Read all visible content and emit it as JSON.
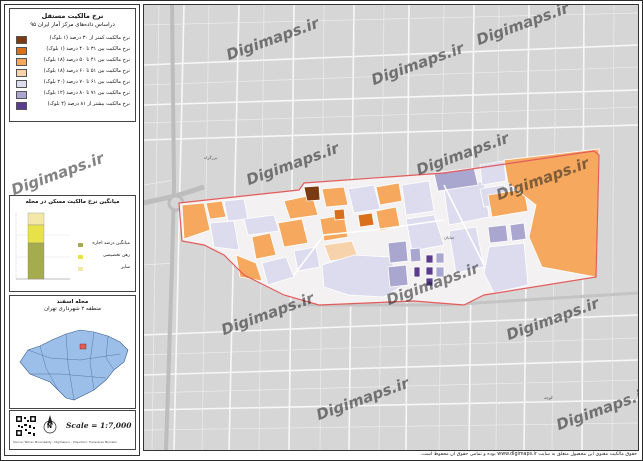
{
  "legend": {
    "title": "نرخ مالکیت مستقل",
    "subtitle": "دراساس داده‌های مرکز آمار ایران ۹۵",
    "items": [
      {
        "label": "نرخ مالکیت کمتر از ۳۰ درصد (۱ بلوک)",
        "color": "#7a3b12"
      },
      {
        "label": "نرخ مالکیت بین ۳۱ تا ۴۰ درصد (۱ بلوک)",
        "color": "#d9701c"
      },
      {
        "label": "نرخ مالکیت بین ۴۱ تا ۵۰ درصد (۱۸ بلوک)",
        "color": "#f5a85e"
      },
      {
        "label": "نرخ مالکیت بین ۵۱ تا ۶۰ درصد (۱۸ بلوک)",
        "color": "#f7d3ab"
      },
      {
        "label": "نرخ مالکیت بین ۶۱ تا ۷۰ درصد (۲۰ بلوک)",
        "color": "#dcdcee"
      },
      {
        "label": "نرخ مالکیت بین ۷۱ تا ۸۰ درصد (۱۲ بلوک)",
        "color": "#a9a6cf"
      },
      {
        "label": "نرخ مالکیت بیشتر از ۸۱ درصد (۴ بلوک)",
        "color": "#5b3d8f"
      }
    ]
  },
  "chart": {
    "title": "میانگین نرخ مالکیت مسکن در محله",
    "items": [
      {
        "label": "میانگین درصد اجاره",
        "color": "#a4ac4e"
      },
      {
        "label": "رهن تخصیصی",
        "color": "#e8e24a"
      },
      {
        "label": "سایر",
        "color": "#f4e8a8"
      }
    ]
  },
  "locator": {
    "neighborhood": "محله اسفند",
    "region": "منطقه ۲ شهرداری تهران"
  },
  "scale": "Scale = 1:7,000",
  "north": "N",
  "small_credit": "Source: Tehran Municipality - Digimaps.ir - Projection: Transverse Mercator",
  "footer": "حقوق مالکیت معنوی این محصول متعلق به سایت www.digimaps.ir بوده و تمامی حقوق آن محفوظ است.",
  "watermark": "Digimaps.ir",
  "colors": {
    "boundary": "#e45b5b",
    "roads": "#f7f7f7",
    "background": "#d6d6d6",
    "tehran_fill": "#9bbfe8"
  }
}
